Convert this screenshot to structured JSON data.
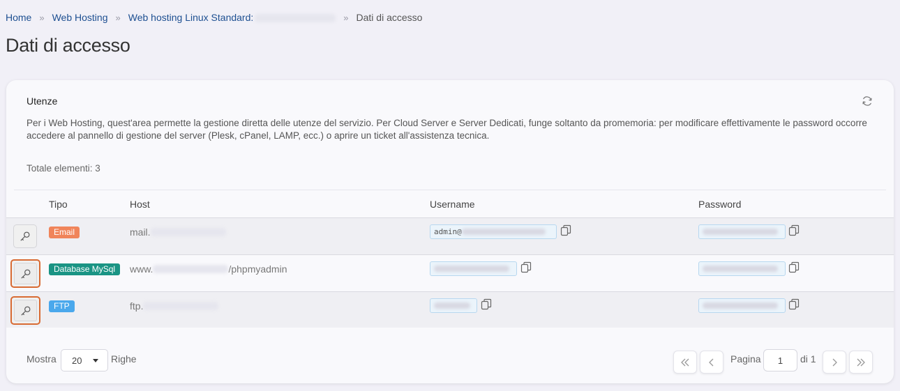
{
  "breadcrumb": {
    "home": "Home",
    "web_hosting": "Web Hosting",
    "product": "Web hosting Linux Standard:",
    "current": "Dati di accesso",
    "separator": "»"
  },
  "page_title": "Dati di accesso",
  "card": {
    "title": "Utenze",
    "description": "Per i Web Hosting, quest'area permette la gestione diretta delle utenze del servizio. Per Cloud Server e Server Dedicati, funge soltanto da promemoria: per modificare effettivamente le password occorre accedere al pannello di gestione del server (Plesk, cPanel, LAMP, ecc.) o aprire un ticket all'assistenza tecnica.",
    "total": "Totale elementi: 3"
  },
  "table": {
    "headers": {
      "tipo": "Tipo",
      "host": "Host",
      "username": "Username",
      "password": "Password"
    },
    "rows": [
      {
        "type": "Email",
        "type_color": "#f0845a",
        "host_prefix": "mail.",
        "host_suffix": "",
        "username_prefix": "admin@",
        "username_blur": true,
        "password_blur": true
      },
      {
        "type": "Database MySql",
        "type_color": "#1a9484",
        "host_prefix": "www.",
        "host_suffix": "/phpmyadmin",
        "username_prefix": "",
        "username_blur": true,
        "password_blur": true
      },
      {
        "type": "FTP",
        "type_color": "#4aa8ec",
        "host_prefix": "ftp.",
        "host_suffix": "",
        "username_prefix": "",
        "username_blur": true,
        "password_blur": true
      }
    ]
  },
  "footer": {
    "show_label": "Mostra",
    "rows_value": "20",
    "rows_label": "Righe",
    "page_label": "Pagina",
    "page_value": "1",
    "of_label": "di 1"
  },
  "colors": {
    "link": "#1d4f91",
    "highlight": "#d86b33",
    "field_bg": "#ebf4fb",
    "field_border": "#b7d7ef"
  },
  "icons": {
    "row_action": "key-icon",
    "copy": "copy-icon",
    "refresh": "refresh-icon",
    "first": "double-chevron-left-icon",
    "prev": "chevron-left-icon",
    "next": "chevron-right-icon",
    "last": "double-chevron-right-icon"
  }
}
